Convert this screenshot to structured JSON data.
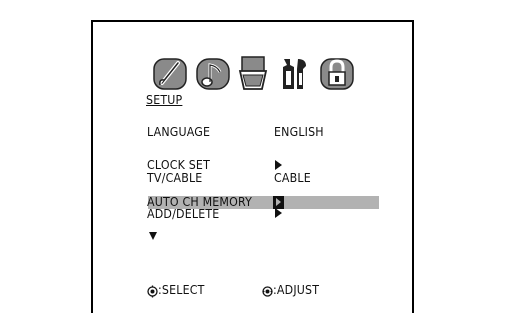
{
  "menu": {
    "title": "SETUP",
    "icons": [
      {
        "name": "picture-brush-icon"
      },
      {
        "name": "audio-note-icon"
      },
      {
        "name": "timer-glass-icon"
      },
      {
        "name": "setup-tools-icon"
      },
      {
        "name": "lock-icon"
      }
    ],
    "items": [
      {
        "label": "LANGUAGE",
        "value": "ENGLISH"
      },
      {
        "label": "CLOCK SET",
        "value": ""
      },
      {
        "label": "TV/CABLE",
        "value": "CABLE"
      },
      {
        "label": "AUTO CH MEMORY",
        "value": ""
      },
      {
        "label": "ADD/DELETE",
        "value": ""
      }
    ]
  },
  "footer": {
    "select_label": ":SELECT",
    "adjust_label": ":ADJUST"
  },
  "colors": {
    "highlight": "#b2b2b2",
    "icon_gray": "#8a8a8a",
    "text": "#111111"
  }
}
